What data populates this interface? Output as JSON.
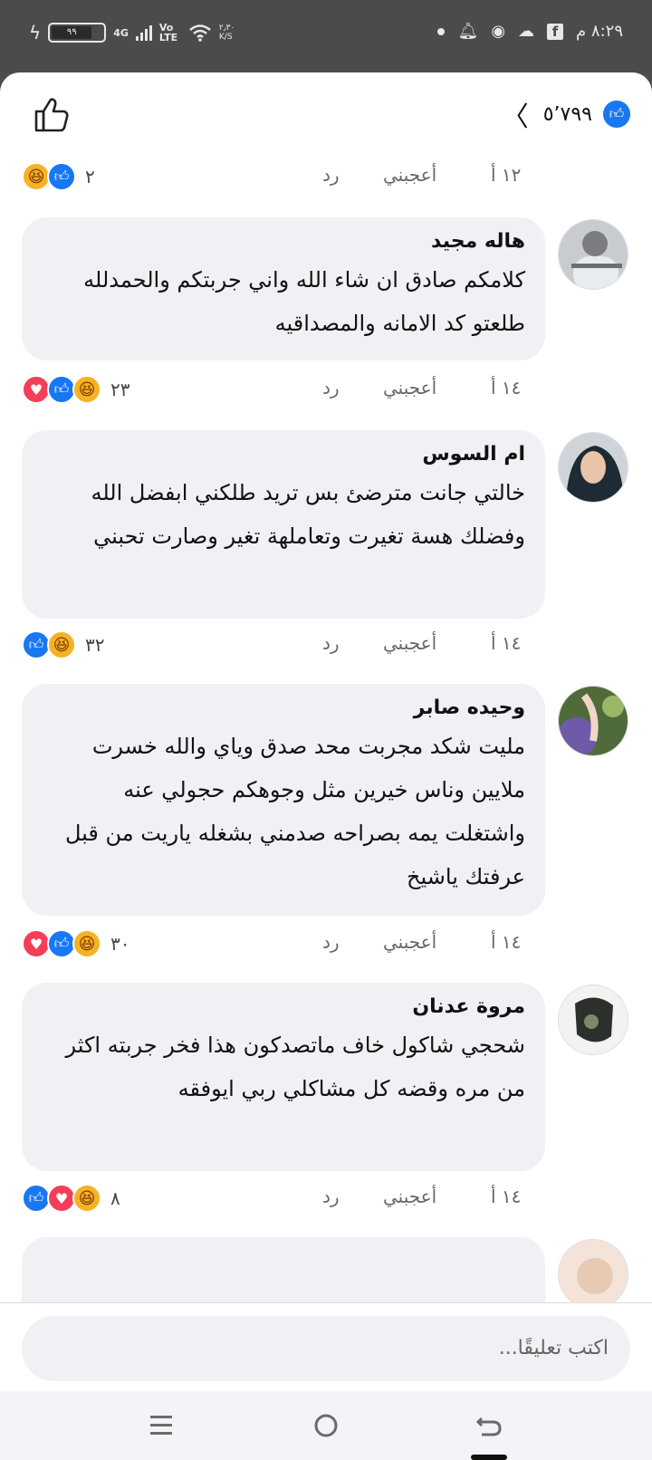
{
  "status_bar": {
    "time": "٨:٢٩ م",
    "battery": "٩٩",
    "network": "4G",
    "volte": "Vo LTE",
    "speed_value": "٢٫٣٠",
    "speed_unit": "K/S"
  },
  "header": {
    "like_count": "٥٬٧٩٩"
  },
  "labels": {
    "reply": "رد",
    "like": "أعجبني"
  },
  "first_meta": {
    "time": "١٢ أ",
    "reaction_count": "٢",
    "reactions": [
      "like-icon",
      "haha-icon"
    ]
  },
  "comments": [
    {
      "name": "هاله مجيد",
      "text": "كلامكم صادق ان شاء الله واني جربتكم والحمدلله طلعتو كد الامانه والمصداقيه",
      "time": "١٤ أ",
      "reaction_count": "٢٣",
      "reactions": [
        "haha-icon",
        "like-icon",
        "love-icon"
      ]
    },
    {
      "name": "ام السوس",
      "text": "خالتي جانت مترضئ بس تريد طلكني ابفضل الله وفضلك هسة تغيرت وتعاملهة تغير وصارت تحبني",
      "time": "١٤ أ",
      "reaction_count": "٣٢",
      "reactions": [
        "haha-icon",
        "like-icon"
      ]
    },
    {
      "name": "وحيده صابر",
      "text": "مليت شكد مجربت محد صدق وياي والله خسرت ملايين وناس خيرين مثل وجوهكم حجولي عنه واشتغلت يمه بصراحه صدمني بشغله ياريت من قبل عرفتك ياشيخ",
      "time": "١٤ أ",
      "reaction_count": "٣٠",
      "reactions": [
        "haha-icon",
        "like-icon",
        "love-icon"
      ]
    },
    {
      "name": "مروة عدنان",
      "text": "شحجي شاكول خاف ماتصدكون هذا فخر جربته اكثر من مره وقضه كل مشاكلي ربي ايوفقه",
      "time": "١٤ أ",
      "reaction_count": "٨",
      "reactions": [
        "haha-icon",
        "love-icon",
        "like-icon"
      ]
    }
  ],
  "composer": {
    "placeholder": "اكتب تعليقًا..."
  },
  "colors": {
    "accent": "#1877f2",
    "love": "#f33e58",
    "haha": "#f7b125",
    "bubble": "#f0f1f5"
  }
}
